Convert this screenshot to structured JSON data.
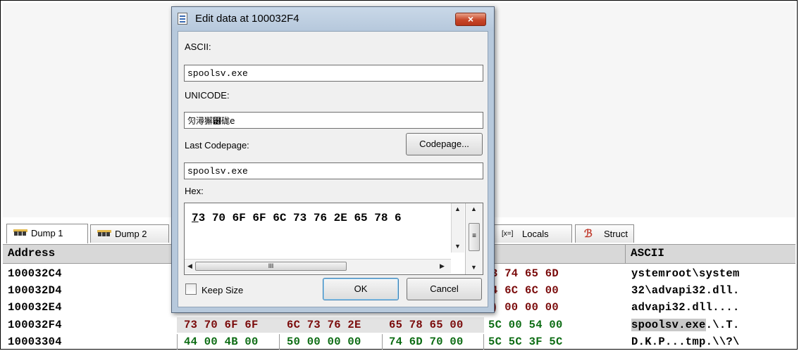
{
  "dialog": {
    "title": "Edit data at 100032F4",
    "close_glyph": "×",
    "ascii_label": "ASCII:",
    "ascii_value": "spoolsv.exe",
    "unicode_label": "UNICODE:",
    "unicode_value": "灳潯獬⹶硥e",
    "codepage_label": "Last Codepage:",
    "codepage_button": "Codepage...",
    "codepage_value": "spoolsv.exe",
    "hex_label": "Hex:",
    "hex_first": "7",
    "hex_rest": "3 70 6F 6F 6C 73 76 2E 65 78 6",
    "scroll_thumb_glyph": "III",
    "keep_size_label": "Keep Size",
    "keep_size_checked": false,
    "ok_label": "OK",
    "cancel_label": "Cancel"
  },
  "tabs": {
    "dump1": "Dump 1",
    "dump2": "Dump 2",
    "locals": "Locals",
    "struct": "Struct"
  },
  "dump": {
    "header_address": "Address",
    "header_ascii": "ASCII",
    "rows": [
      {
        "address": "100032C4",
        "hex_visible": "3 74 65 6D",
        "ascii": "ystemroot\\system"
      },
      {
        "address": "100032D4",
        "hex_visible": "4 6C 6C 00",
        "ascii": "32\\advapi32.dll."
      },
      {
        "address": "100032E4",
        "hex_visible": ") 00 00 00",
        "ascii": "advapi32.dll...."
      },
      {
        "address": "100032F4",
        "hex_groups": [
          "73 70 6F 6F",
          "6C 73 76 2E",
          "65 78 65 00",
          "5C 00 54 00"
        ],
        "ascii_selected": "spoolsv.exe",
        "ascii_rest": ".\\.T."
      },
      {
        "address": "10003304",
        "hex_groups": [
          "44 00 4B 00",
          "50 00 00 00",
          "74 6D 70 00",
          "5C 5C 3F 5C"
        ],
        "ascii": "D.K.P...tmp.\\\\?\\"
      }
    ]
  }
}
